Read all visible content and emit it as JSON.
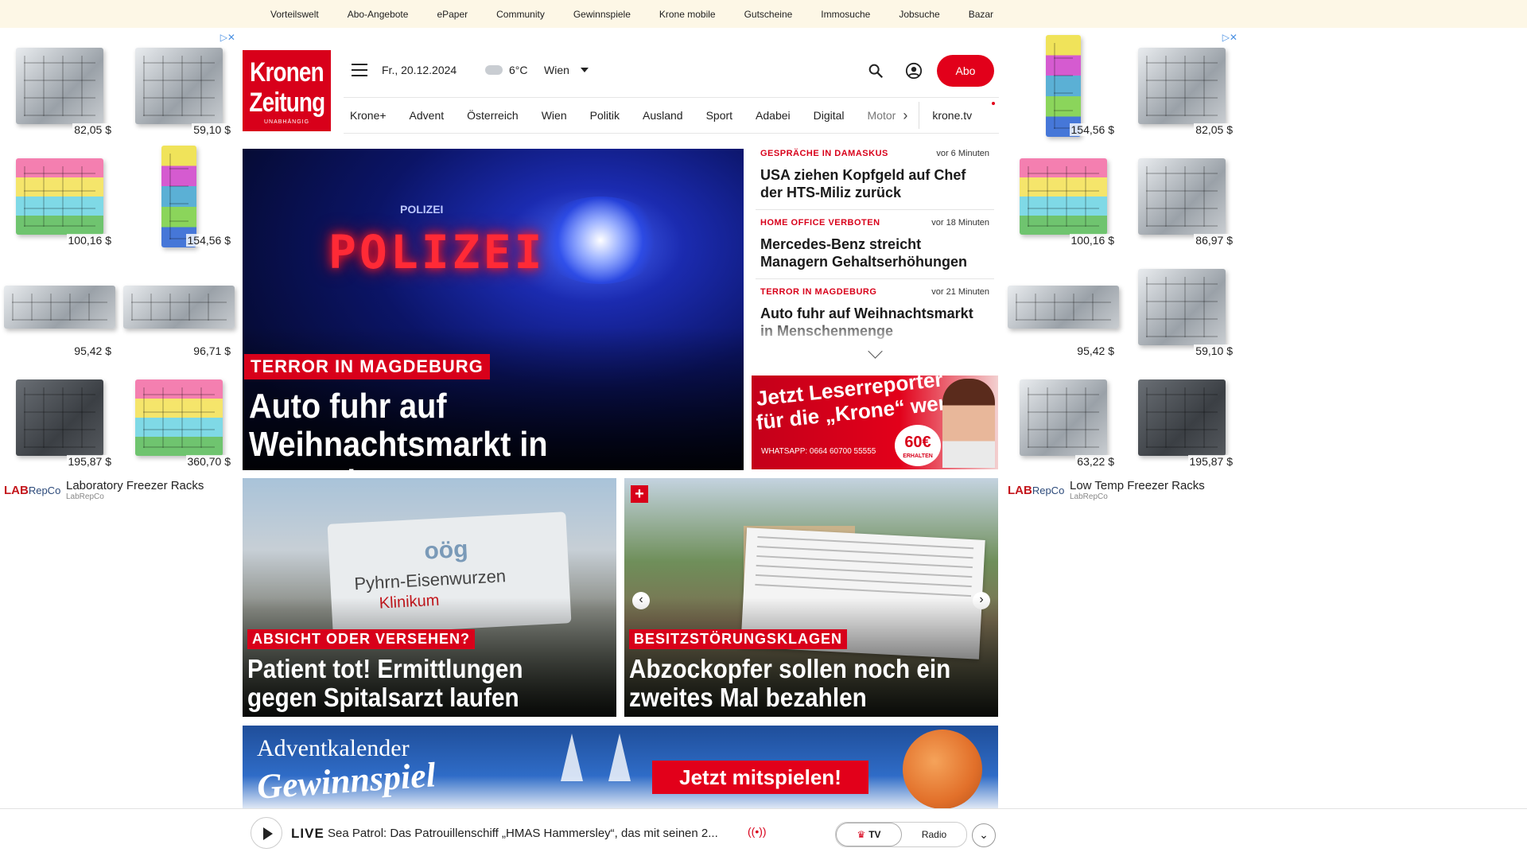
{
  "topbar": {
    "links": [
      "Vorteilswelt",
      "Abo-Angebote",
      "ePaper",
      "Community",
      "Gewinnspiele",
      "Krone mobile",
      "Gutscheine",
      "Immosuche",
      "Jobsuche",
      "Bazar"
    ]
  },
  "ad_left": {
    "prices": [
      "82,05 $",
      "59,10 $",
      "100,16 $",
      "154,56 $",
      "95,42 $",
      "96,71 $",
      "195,87 $",
      "360,70 $"
    ],
    "logo": "LAB",
    "logo_suffix": "RepCo",
    "title": "Laboratory Freezer Racks",
    "sub": "LabRepCo"
  },
  "ad_right": {
    "prices": [
      "154,56 $",
      "82,05 $",
      "100,16 $",
      "86,97 $",
      "95,42 $",
      "59,10 $",
      "63,22 $",
      "195,87 $"
    ],
    "logo": "LAB",
    "logo_suffix": "RepCo",
    "title": "Low Temp Freezer Racks",
    "sub": "LabRepCo"
  },
  "header": {
    "logo_line1": "Kronen",
    "logo_line2": "Zeitung",
    "logo_line3": "UNABHÄNGIG",
    "date": "Fr., 20.12.2024",
    "temp": "6°C",
    "city": "Wien",
    "abo": "Abo"
  },
  "nav": {
    "items": [
      "Krone+",
      "Advent",
      "Österreich",
      "Wien",
      "Politik",
      "Ausland",
      "Sport",
      "Adabei",
      "Digital",
      "Motor"
    ],
    "tv": "krone.tv"
  },
  "hero": {
    "image_text": "POLIZEI",
    "image_text_small": "POLIZEI",
    "kicker": "TERROR IN MAGDEBURG",
    "headline": "Auto fuhr auf Weihnachtsmarkt in Menschenmenge"
  },
  "news": [
    {
      "tag": "GESPRÄCHE IN DAMASKUS",
      "time": "vor 6 Minuten",
      "title": "USA ziehen Kopfgeld auf Chef der HTS-Miliz zurück"
    },
    {
      "tag": "HOME OFFICE VERBOTEN",
      "time": "vor 18 Minuten",
      "title": "Mercedes-Benz streicht Managern Gehaltserhöhungen"
    },
    {
      "tag": "TERROR IN MAGDEBURG",
      "time": "vor 21 Minuten",
      "title": "Auto fuhr auf Weihnachtsmarkt in Menschenmenge"
    }
  ],
  "promo": {
    "line1": "Jetzt Leserreporter",
    "line2": "für die „Krone“ werden",
    "wa": "WHATSAPP: 0664 60700 55555",
    "badge": "60€",
    "badge_sub": "ERHALTEN"
  },
  "cards": [
    {
      "kicker": "ABSICHT ODER VERSEHEN?",
      "headline": "Patient tot! Ermittlungen gegen Spitalsarzt laufen",
      "sign1": "oög",
      "sign2": "Pyhrn-Eisenwurzen",
      "sign3": "Klinikum"
    },
    {
      "kicker": "BESITZSTÖRUNGSKLAGEN",
      "headline": "Abzockopfer sollen noch ein zweites Mal bezahlen"
    }
  ],
  "banner": {
    "line1": "Adventkalender",
    "line2": "Gewinnspiel",
    "cta": "Jetzt mitspielen!"
  },
  "player": {
    "live": "LIVE",
    "title": "Sea Patrol: Das Patrouillenschiff „HMAS Hammersley“, das mit seinen 2...",
    "tv": "TV",
    "radio": "Radio"
  },
  "colors": {
    "brand_red": "#d8001a",
    "topbar_bg": "#fdf7e6"
  }
}
